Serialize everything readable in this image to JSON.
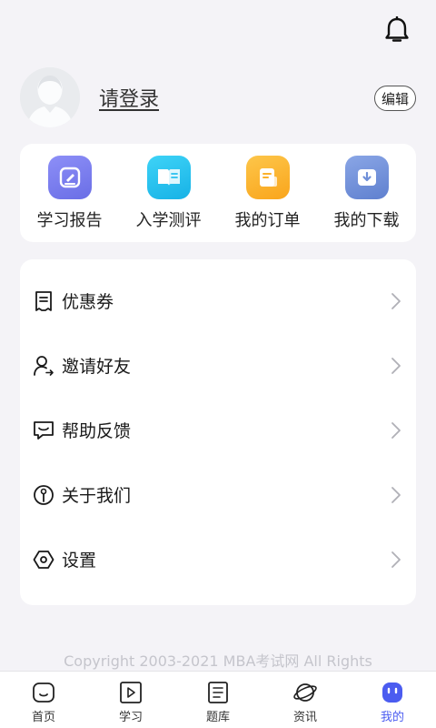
{
  "header": {
    "bell_icon": "bell-icon"
  },
  "profile": {
    "login_text": "请登录",
    "edit_label": "编辑",
    "avatar_icon": "default-avatar"
  },
  "quick_actions": [
    {
      "label": "学习报告",
      "icon": "report-icon",
      "color": "#7a7ff0"
    },
    {
      "label": "入学测评",
      "icon": "book-icon",
      "color": "#27c0ef"
    },
    {
      "label": "我的订单",
      "icon": "order-icon",
      "color": "#fbb12c"
    },
    {
      "label": "我的下载",
      "icon": "download-icon",
      "color": "#6f8fd8"
    }
  ],
  "menu": [
    {
      "label": "优惠券",
      "icon": "coupon-icon"
    },
    {
      "label": "邀请好友",
      "icon": "invite-user-icon"
    },
    {
      "label": "帮助反馈",
      "icon": "feedback-icon"
    },
    {
      "label": "关于我们",
      "icon": "info-icon"
    },
    {
      "label": "设置",
      "icon": "settings-icon"
    }
  ],
  "copyright": "Copyright 2003-2021 MBA考试网 All Rights",
  "tabs": [
    {
      "label": "首页",
      "icon": "home-icon",
      "active": false
    },
    {
      "label": "学习",
      "icon": "play-icon",
      "active": false
    },
    {
      "label": "题库",
      "icon": "question-bank-icon",
      "active": false
    },
    {
      "label": "资讯",
      "icon": "planet-icon",
      "active": false
    },
    {
      "label": "我的",
      "icon": "profile-icon",
      "active": true
    }
  ],
  "colors": {
    "accent": "#4b5cf0",
    "background": "#f4f3f7"
  }
}
